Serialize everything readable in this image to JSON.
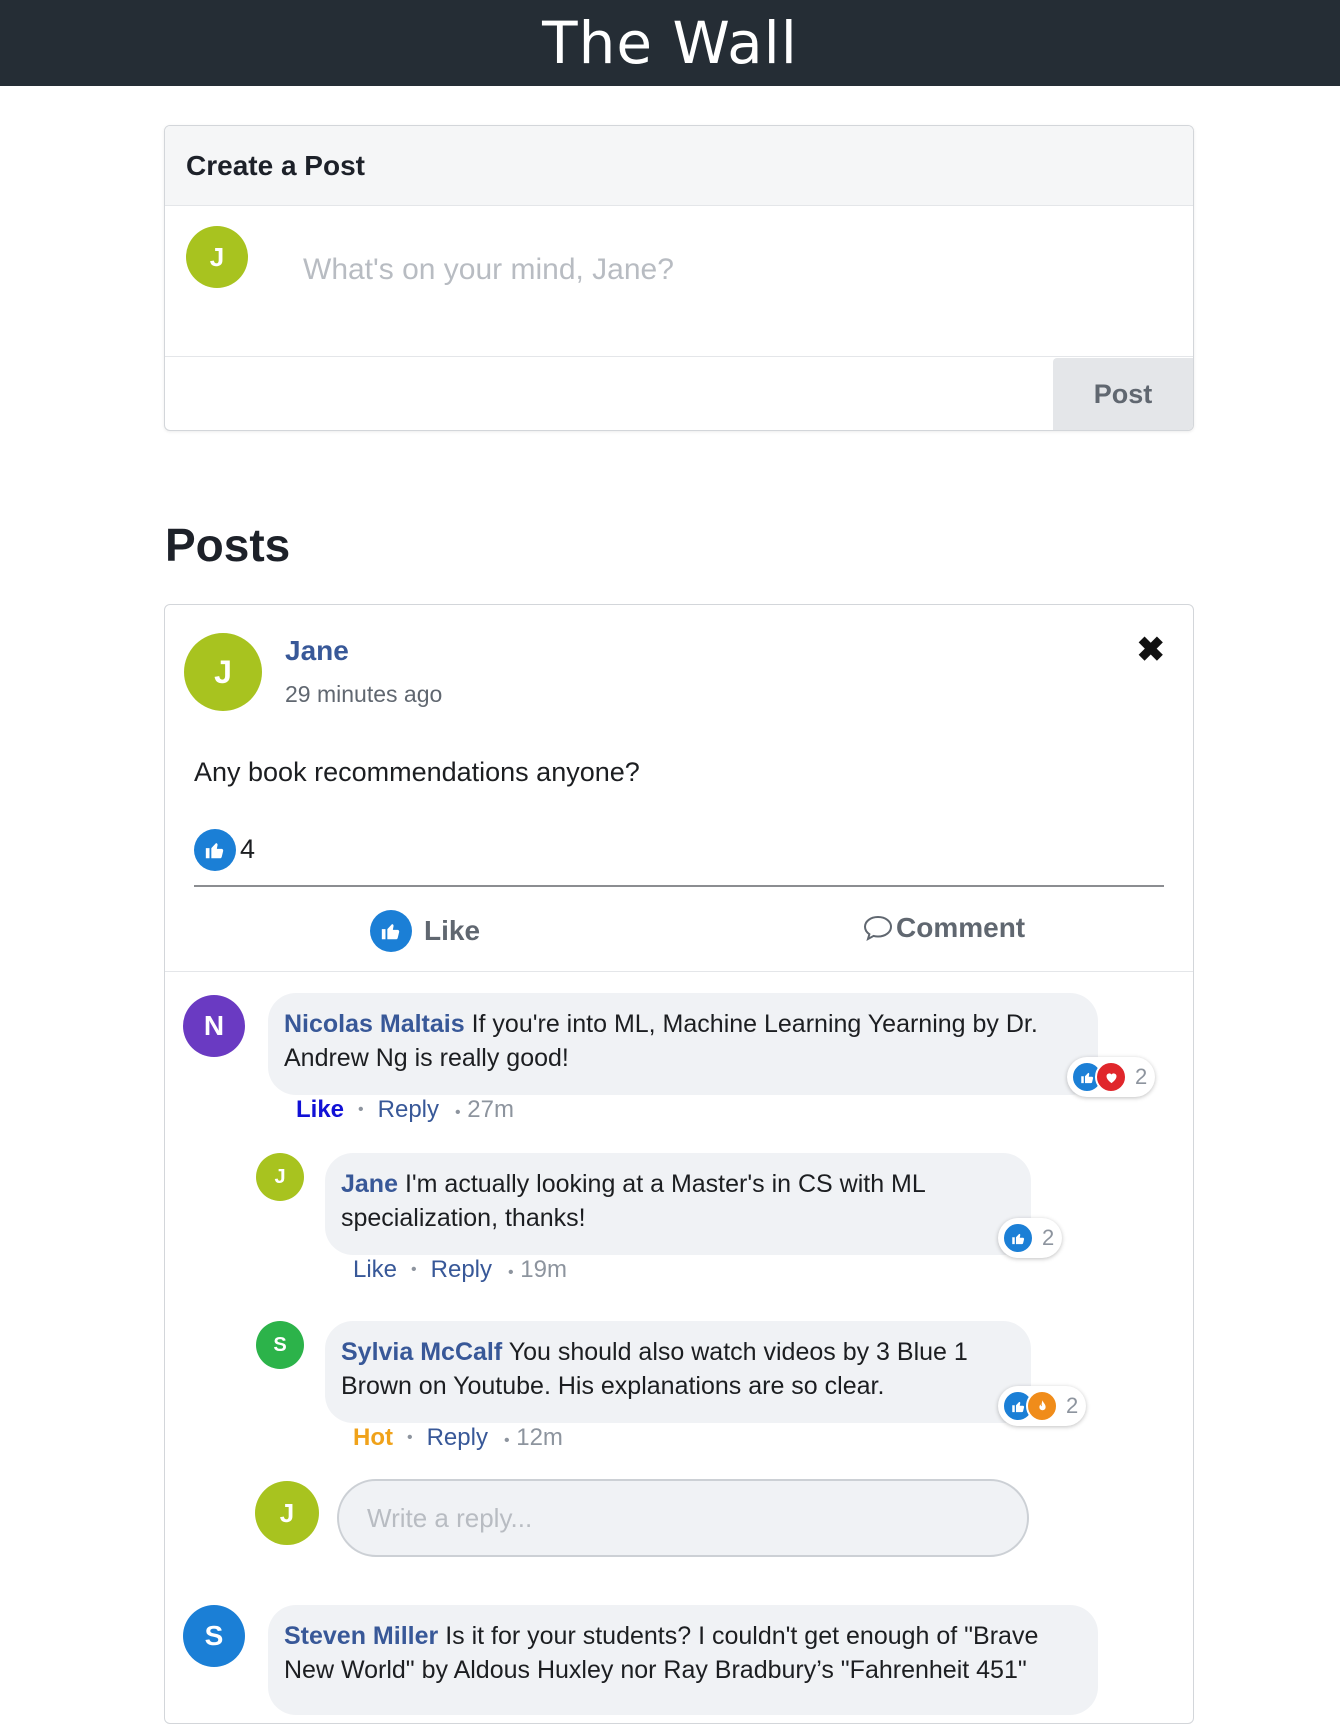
{
  "app": {
    "title": "The Wall"
  },
  "create_post": {
    "heading": "Create a Post",
    "avatar_initial": "J",
    "placeholder": "What's on your mind, Jane?",
    "post_button": "Post"
  },
  "posts_heading": "Posts",
  "post": {
    "author": "Jane",
    "avatar_initial": "J",
    "time": "29 minutes ago",
    "text": "Any book recommendations anyone?",
    "like_count": "4",
    "like_label": "Like",
    "comment_label": "Comment",
    "close_icon": "close-icon"
  },
  "comments": [
    {
      "avatar_initial": "N",
      "author": "Nicolas Maltais",
      "text": "If you're into ML, Machine Learning Yearning by Dr. Andrew Ng is really good!",
      "reaction_count": "2",
      "action_label": "Like",
      "reply_label": "Reply",
      "time": "27m"
    },
    {
      "avatar_initial": "J",
      "author": "Jane",
      "text": "I'm actually looking at a Master's in CS with ML specialization, thanks!",
      "reaction_count": "2",
      "action_label": "Like",
      "reply_label": "Reply",
      "time": "19m"
    },
    {
      "avatar_initial": "S",
      "author": "Sylvia McCalf",
      "text": "You should also watch videos by 3 Blue 1 Brown on Youtube. His explanations are so clear.",
      "reaction_count": "2",
      "action_label": "Hot",
      "reply_label": "Reply",
      "time": "12m"
    },
    {
      "avatar_initial": "S",
      "author": "Steven Miller",
      "text": "Is it for your students? I couldn't get enough of \"Brave New World\" by Aldous Huxley nor Ray Bradbury’s \"Fahrenheit 451\""
    }
  ],
  "reply_input": {
    "avatar_initial": "J",
    "placeholder": "Write a reply..."
  },
  "colors": {
    "header_bg": "#252d35",
    "avatar_jane": "#a8c31f",
    "avatar_nicolas": "#6a3ac2",
    "avatar_sylvia": "#2cb34a",
    "avatar_steven": "#1b7fd6",
    "like_blue": "#1b7fd6",
    "love_red": "#e0262b",
    "hot_orange": "#f08c1a",
    "link_blue": "#385898"
  }
}
